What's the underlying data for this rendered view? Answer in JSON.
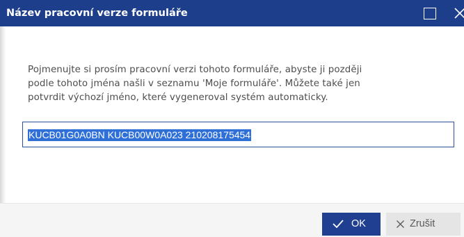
{
  "dialog": {
    "title": "Název pracovní verze formuláře",
    "title_bar_icons": [
      "maximize-icon",
      "close-icon"
    ]
  },
  "message": {
    "lines": [
      "Pojmenujte si prosím pracovní verzi tohoto formuláře, abyste ji později",
      "podle tohoto jména našli v seznamu 'Moje formuláře'. Můžete také jen",
      "potvrdit výchozí jméno, které vygeneroval systém automaticky."
    ]
  },
  "name_input": {
    "value": "KUCB01G0A0BN KUCB00W0A023 210208175454",
    "text_selected": true
  },
  "buttons": {
    "ok": {
      "label": "OK",
      "icon": "checkmark-icon"
    },
    "cancel": {
      "label": "Zrušit",
      "icon": "x-icon"
    }
  },
  "colors": {
    "title_bar": "#1d3e8a",
    "primary_button": "#203f91",
    "secondary_button": "#e5e5e5",
    "selection": "#2f6fd8",
    "input_border": "#2a4e9a",
    "footer": "#f5f5f5"
  }
}
